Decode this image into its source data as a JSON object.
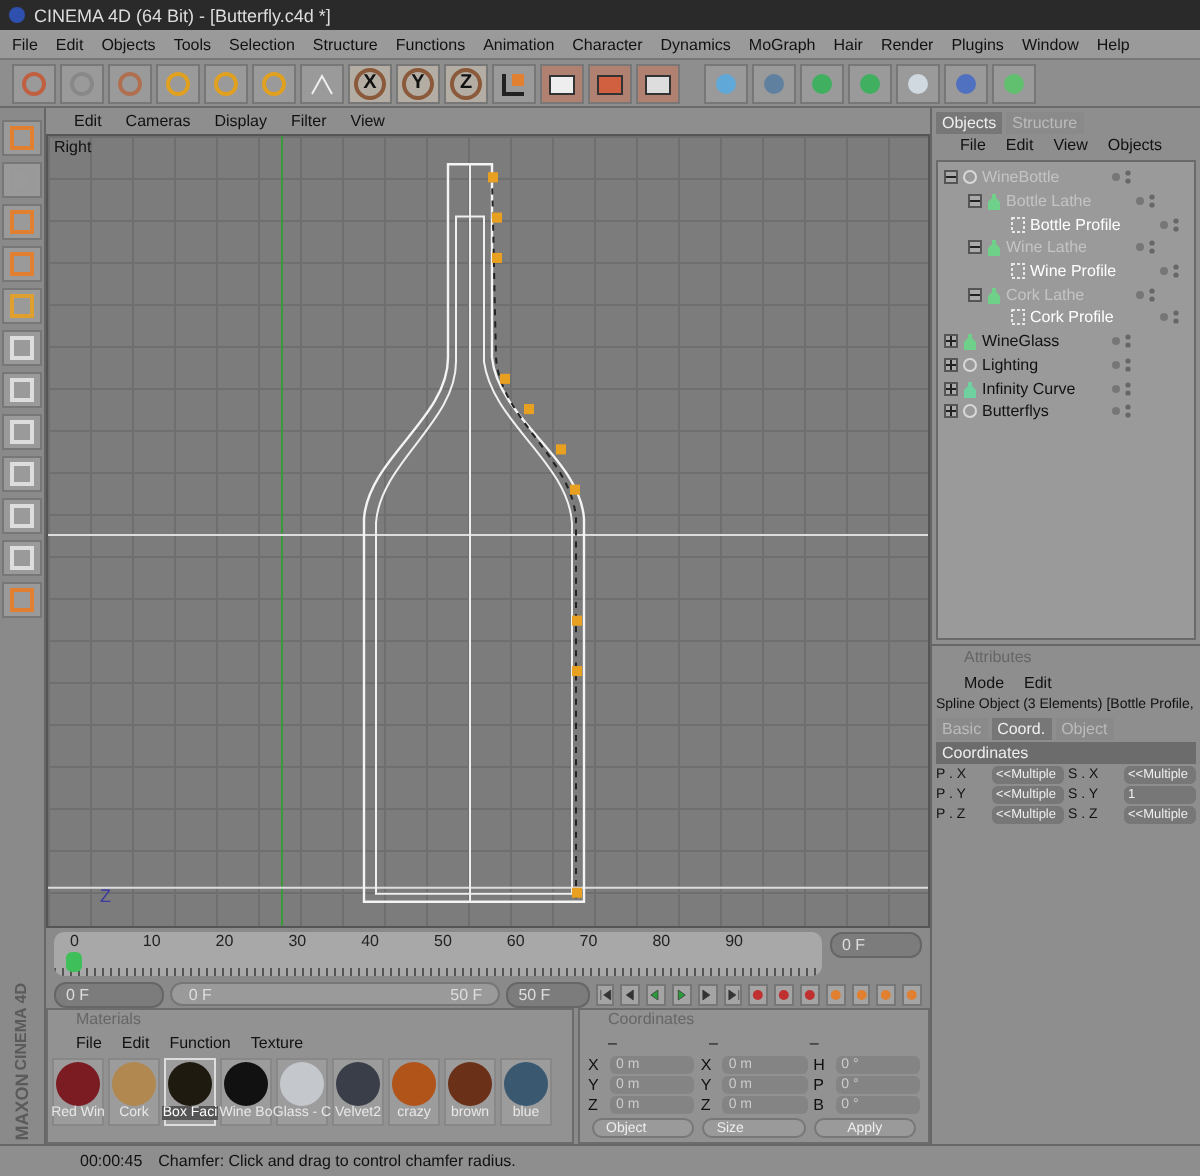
{
  "window": {
    "title": "CINEMA 4D (64 Bit) - [Butterfly.c4d *]"
  },
  "menu": [
    "File",
    "Edit",
    "Objects",
    "Tools",
    "Selection",
    "Structure",
    "Functions",
    "Animation",
    "Character",
    "Dynamics",
    "MoGraph",
    "Hair",
    "Render",
    "Plugins",
    "Window",
    "Help"
  ],
  "toolbar": {
    "axis_buttons": [
      "X",
      "Y",
      "Z"
    ]
  },
  "viewport": {
    "menu": [
      "Edit",
      "Cameras",
      "Display",
      "Filter",
      "View"
    ],
    "label": "Right",
    "axis_label": "Z"
  },
  "timeline": {
    "ticks": [
      "0",
      "10",
      "20",
      "30",
      "40",
      "50",
      "60",
      "70",
      "80",
      "90"
    ],
    "frame_field": "0 F"
  },
  "playback": {
    "start_field": "0 F",
    "range_start": "0 F",
    "range_end": "50 F",
    "level": 1,
    "end_field": "50 F"
  },
  "materials": {
    "title": "Materials",
    "menu": [
      "File",
      "Edit",
      "Function",
      "Texture"
    ],
    "items": [
      {
        "name": "Red Win",
        "selected": false,
        "color": "#7a1c22"
      },
      {
        "name": "Cork",
        "selected": false,
        "color": "#b08850"
      },
      {
        "name": "Box Faci",
        "selected": true,
        "color": "#1e1a10"
      },
      {
        "name": "Wine Bo",
        "selected": false,
        "color": "#111111"
      },
      {
        "name": "Glass - C",
        "selected": false,
        "color": "#c4c8cc"
      },
      {
        "name": "Velvet2",
        "selected": false,
        "color": "#3a3e48"
      },
      {
        "name": "crazy",
        "selected": false,
        "color": "#b0541a"
      },
      {
        "name": "brown",
        "selected": false,
        "color": "#6a3018"
      },
      {
        "name": "blue",
        "selected": false,
        "color": "#3a5870"
      }
    ]
  },
  "coordinates": {
    "title": "Coordinates",
    "headers": [
      "–",
      "–",
      "–"
    ],
    "rows": [
      {
        "p_label": "X",
        "position": "0 m",
        "s_label": "X",
        "size": "0 m",
        "r_label": "H",
        "rotation": "0 °"
      },
      {
        "p_label": "Y",
        "position": "0 m",
        "s_label": "Y",
        "size": "0 m",
        "r_label": "P",
        "rotation": "0 °"
      },
      {
        "p_label": "Z",
        "position": "0 m",
        "s_label": "Z",
        "size": "0 m",
        "r_label": "B",
        "rotation": "0 °"
      }
    ],
    "dropdowns": [
      "Object",
      "Size"
    ],
    "apply": "Apply"
  },
  "objects": {
    "tabs": [
      {
        "label": "Objects",
        "selected": true
      },
      {
        "label": "Structure",
        "selected": false
      }
    ],
    "menu": [
      "File",
      "Edit",
      "View",
      "Objects"
    ],
    "tree": [
      {
        "name": "WineBottle",
        "kind": "null",
        "expanded": true,
        "selected": false,
        "muted": true,
        "children": [
          {
            "name": "Bottle Lathe",
            "kind": "lathe",
            "expanded": true,
            "selected": false,
            "muted": true,
            "children": [
              {
                "name": "Bottle Profile",
                "kind": "spline",
                "selected": true
              }
            ]
          },
          {
            "name": "Wine Lathe",
            "kind": "lathe",
            "expanded": true,
            "selected": false,
            "muted": true,
            "children": [
              {
                "name": "Wine Profile",
                "kind": "spline",
                "selected": true
              }
            ]
          },
          {
            "name": "Cork Lathe",
            "kind": "lathe",
            "expanded": true,
            "selected": false,
            "muted": true,
            "children": [
              {
                "name": "Cork Profile",
                "kind": "spline",
                "selected": true
              }
            ]
          }
        ]
      },
      {
        "name": "WineGlass",
        "kind": "lathe",
        "expanded": false,
        "selected": false,
        "muted": false
      },
      {
        "name": "Lighting",
        "kind": "null",
        "expanded": false,
        "selected": false,
        "muted": false
      },
      {
        "name": "Infinity Curve",
        "kind": "curve",
        "expanded": false,
        "selected": false,
        "muted": false
      },
      {
        "name": "Butterflys",
        "kind": "null",
        "expanded": false,
        "selected": false,
        "muted": false
      }
    ]
  },
  "attributes": {
    "title": "Attributes",
    "menu": [
      "Mode",
      "Edit"
    ],
    "object": "Spline Object (3 Elements) [Bottle Profile,",
    "tabs": [
      {
        "label": "Basic",
        "selected": false
      },
      {
        "label": "Coord.",
        "selected": true
      },
      {
        "label": "Object",
        "selected": false
      }
    ],
    "section": "Coordinates",
    "rows": [
      {
        "left_label": "P . X",
        "left_value": "<<Multiple",
        "right_label": "S . X",
        "right_value": "<<Multiple"
      },
      {
        "left_label": "P . Y",
        "left_value": "<<Multiple",
        "right_label": "S . Y",
        "right_value": "1"
      },
      {
        "left_label": "P . Z",
        "left_value": "<<Multiple",
        "right_label": "S . Z",
        "right_value": "<<Multiple"
      }
    ]
  },
  "logo": {
    "brand": "MAXON",
    "product": "CINEMA 4D"
  },
  "status_bar": {
    "time": "00:00:45",
    "message": "Chamfer: Click and drag to control chamfer radius."
  }
}
